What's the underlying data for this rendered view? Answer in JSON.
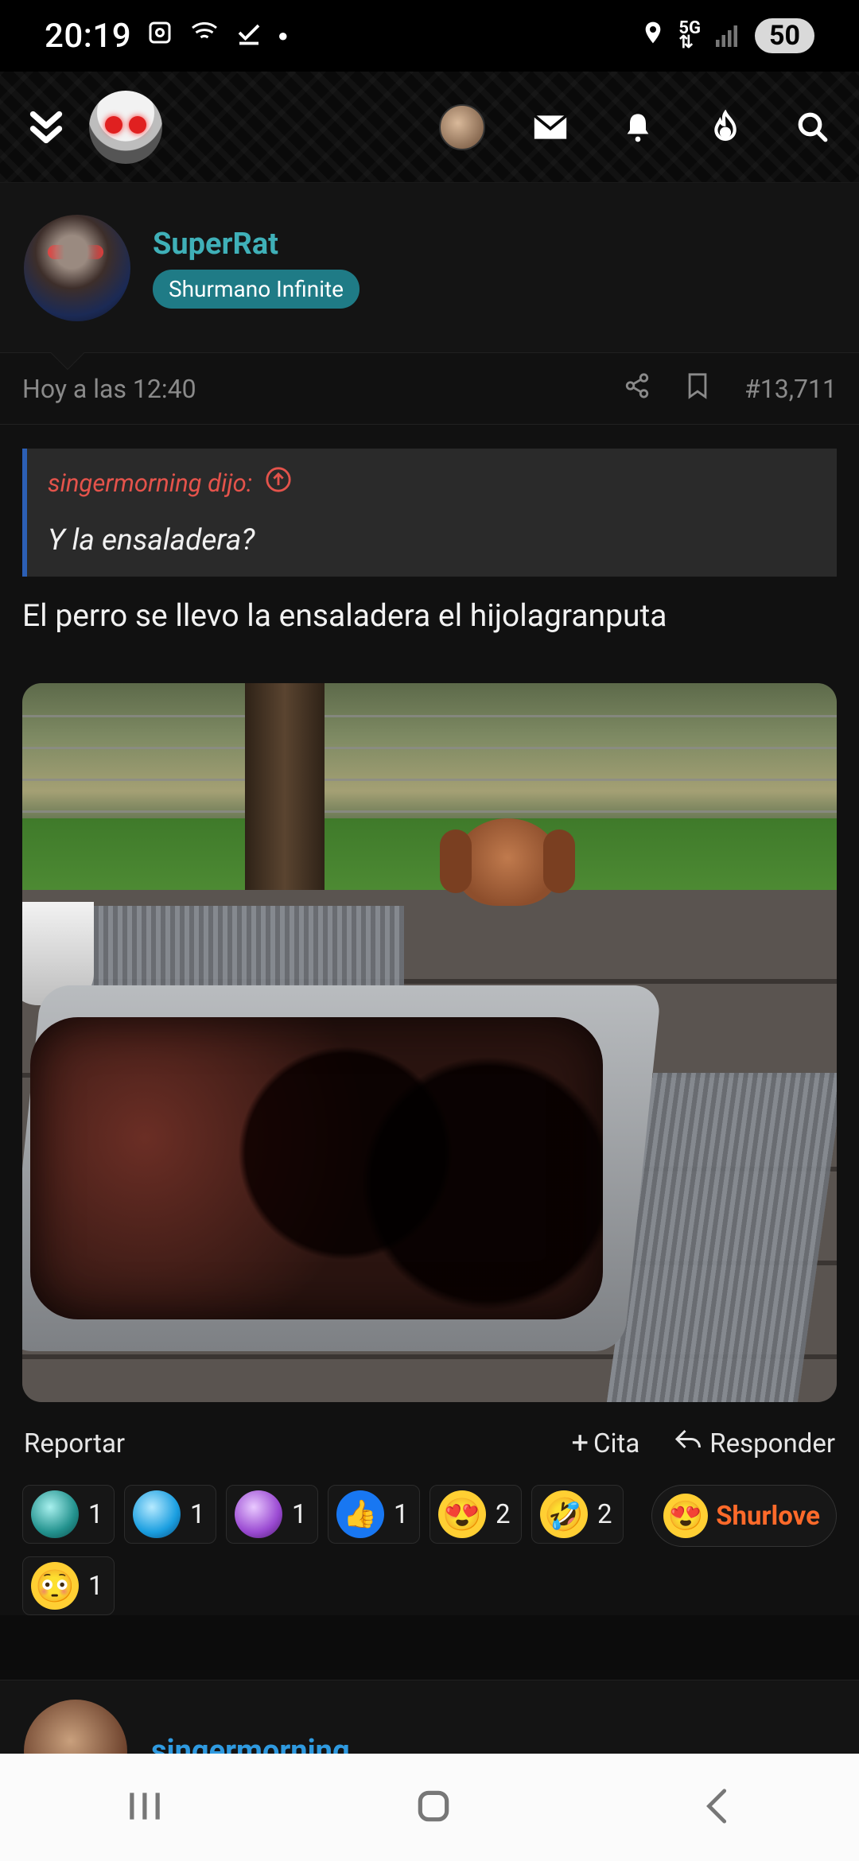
{
  "status_bar": {
    "time": "20:19",
    "battery": "50"
  },
  "top_nav": {
    "icons": [
      "collapse-icon",
      "mascot-logo",
      "user-avatar",
      "mail-icon",
      "bell-icon",
      "fire-icon",
      "search-icon"
    ]
  },
  "post": {
    "author": {
      "name": "SuperRat",
      "badge": "Shurmano Infinite"
    },
    "meta": {
      "timestamp": "Hoy a las 12:40",
      "number": "#13,711"
    },
    "quote": {
      "author": "singermorning dijo:",
      "text": "Y la ensaladera?"
    },
    "text": "El perro se llevo la ensaladera el hijolagranputa",
    "actions": {
      "report": "Reportar",
      "quote": "Cita",
      "reply": "Responder"
    },
    "reactions": [
      {
        "icon": "teal-gem-icon",
        "count": "1"
      },
      {
        "icon": "blue-gem-icon",
        "count": "1"
      },
      {
        "icon": "purple-gem-icon",
        "count": "1"
      },
      {
        "icon": "thumbs-up-icon",
        "count": "1"
      },
      {
        "icon": "heart-eyes-icon",
        "count": "2"
      },
      {
        "icon": "laughing-icon",
        "count": "2"
      },
      {
        "icon": "surprised-icon",
        "count": "1"
      }
    ],
    "shurlove_label": "Shurlove"
  },
  "next_post": {
    "author": "singermorning"
  },
  "colors": {
    "accent_teal": "#3fb0b8",
    "badge_bg": "#1f7b86",
    "quote_red": "#e4534b",
    "link_blue": "#2f9ae0",
    "shurlove_orange": "#ff6a2a"
  }
}
